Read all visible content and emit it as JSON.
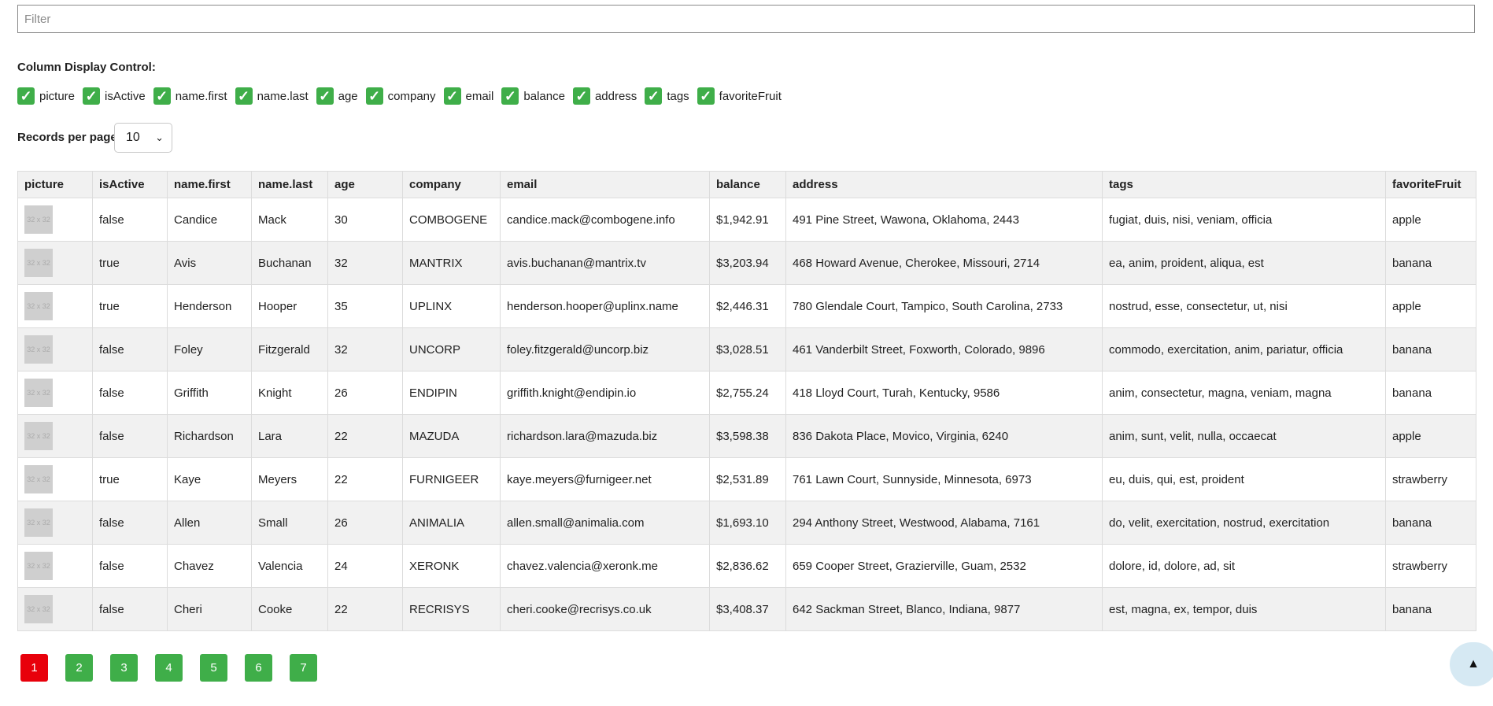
{
  "filter": {
    "placeholder": "Filter",
    "value": ""
  },
  "column_control": {
    "title": "Column Display Control:",
    "columns": [
      {
        "label": "picture",
        "checked": true
      },
      {
        "label": "isActive",
        "checked": true
      },
      {
        "label": "name.first",
        "checked": true
      },
      {
        "label": "name.last",
        "checked": true
      },
      {
        "label": "age",
        "checked": true
      },
      {
        "label": "company",
        "checked": true
      },
      {
        "label": "email",
        "checked": true
      },
      {
        "label": "balance",
        "checked": true
      },
      {
        "label": "address",
        "checked": true
      },
      {
        "label": "tags",
        "checked": true
      },
      {
        "label": "favoriteFruit",
        "checked": true
      }
    ]
  },
  "records_per_page": {
    "label": "Records per page:",
    "value": "10"
  },
  "table": {
    "headers": [
      "picture",
      "isActive",
      "name.first",
      "name.last",
      "age",
      "company",
      "email",
      "balance",
      "address",
      "tags",
      "favoriteFruit"
    ],
    "picture_placeholder": "32 x 32",
    "rows": [
      {
        "isActive": "false",
        "first": "Candice",
        "last": "Mack",
        "age": "30",
        "company": "COMBOGENE",
        "email": "candice.mack@combogene.info",
        "balance": "$1,942.91",
        "address": "491 Pine Street, Wawona, Oklahoma, 2443",
        "tags": "fugiat, duis, nisi, veniam, officia",
        "fruit": "apple"
      },
      {
        "isActive": "true",
        "first": "Avis",
        "last": "Buchanan",
        "age": "32",
        "company": "MANTRIX",
        "email": "avis.buchanan@mantrix.tv",
        "balance": "$3,203.94",
        "address": "468 Howard Avenue, Cherokee, Missouri, 2714",
        "tags": "ea, anim, proident, aliqua, est",
        "fruit": "banana"
      },
      {
        "isActive": "true",
        "first": "Henderson",
        "last": "Hooper",
        "age": "35",
        "company": "UPLINX",
        "email": "henderson.hooper@uplinx.name",
        "balance": "$2,446.31",
        "address": "780 Glendale Court, Tampico, South Carolina, 2733",
        "tags": "nostrud, esse, consectetur, ut, nisi",
        "fruit": "apple"
      },
      {
        "isActive": "false",
        "first": "Foley",
        "last": "Fitzgerald",
        "age": "32",
        "company": "UNCORP",
        "email": "foley.fitzgerald@uncorp.biz",
        "balance": "$3,028.51",
        "address": "461 Vanderbilt Street, Foxworth, Colorado, 9896",
        "tags": "commodo, exercitation, anim, pariatur, officia",
        "fruit": "banana"
      },
      {
        "isActive": "false",
        "first": "Griffith",
        "last": "Knight",
        "age": "26",
        "company": "ENDIPIN",
        "email": "griffith.knight@endipin.io",
        "balance": "$2,755.24",
        "address": "418 Lloyd Court, Turah, Kentucky, 9586",
        "tags": "anim, consectetur, magna, veniam, magna",
        "fruit": "banana"
      },
      {
        "isActive": "false",
        "first": "Richardson",
        "last": "Lara",
        "age": "22",
        "company": "MAZUDA",
        "email": "richardson.lara@mazuda.biz",
        "balance": "$3,598.38",
        "address": "836 Dakota Place, Movico, Virginia, 6240",
        "tags": "anim, sunt, velit, nulla, occaecat",
        "fruit": "apple"
      },
      {
        "isActive": "true",
        "first": "Kaye",
        "last": "Meyers",
        "age": "22",
        "company": "FURNIGEER",
        "email": "kaye.meyers@furnigeer.net",
        "balance": "$2,531.89",
        "address": "761 Lawn Court, Sunnyside, Minnesota, 6973",
        "tags": "eu, duis, qui, est, proident",
        "fruit": "strawberry"
      },
      {
        "isActive": "false",
        "first": "Allen",
        "last": "Small",
        "age": "26",
        "company": "ANIMALIA",
        "email": "allen.small@animalia.com",
        "balance": "$1,693.10",
        "address": "294 Anthony Street, Westwood, Alabama, 7161",
        "tags": "do, velit, exercitation, nostrud, exercitation",
        "fruit": "banana"
      },
      {
        "isActive": "false",
        "first": "Chavez",
        "last": "Valencia",
        "age": "24",
        "company": "XERONK",
        "email": "chavez.valencia@xeronk.me",
        "balance": "$2,836.62",
        "address": "659 Cooper Street, Grazierville, Guam, 2532",
        "tags": "dolore, id, dolore, ad, sit",
        "fruit": "strawberry"
      },
      {
        "isActive": "false",
        "first": "Cheri",
        "last": "Cooke",
        "age": "22",
        "company": "RECRISYS",
        "email": "cheri.cooke@recrisys.co.uk",
        "balance": "$3,408.37",
        "address": "642 Sackman Street, Blanco, Indiana, 9877",
        "tags": "est, magna, ex, tempor, duis",
        "fruit": "banana"
      }
    ]
  },
  "pagination": {
    "pages": [
      "1",
      "2",
      "3",
      "4",
      "5",
      "6",
      "7"
    ],
    "current": "1"
  },
  "scroll_top": {
    "icon": "▲",
    "icon_name": "arrow-up-icon"
  },
  "colors": {
    "checkbox": "#3fae49",
    "page_button": "#3fae49",
    "page_active": "#e8000b",
    "scroll_top_bg": "#d6e9f3"
  }
}
